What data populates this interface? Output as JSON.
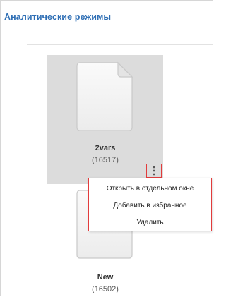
{
  "header": {
    "title": "Аналитические режимы"
  },
  "tiles": [
    {
      "name": "2vars",
      "id": "(16517)"
    },
    {
      "name": "New",
      "id": "(16502)"
    }
  ],
  "context_menu": {
    "trigger_icon": "more-vertical-icon",
    "items": [
      {
        "label": "Открыть в отдельном окне"
      },
      {
        "label": "Добавить в избранное"
      },
      {
        "label": "Удалить"
      }
    ]
  },
  "colors": {
    "title": "#2f6fb5",
    "tile_selected_bg": "#dcdcdc",
    "highlight_border": "#e23c3c"
  }
}
